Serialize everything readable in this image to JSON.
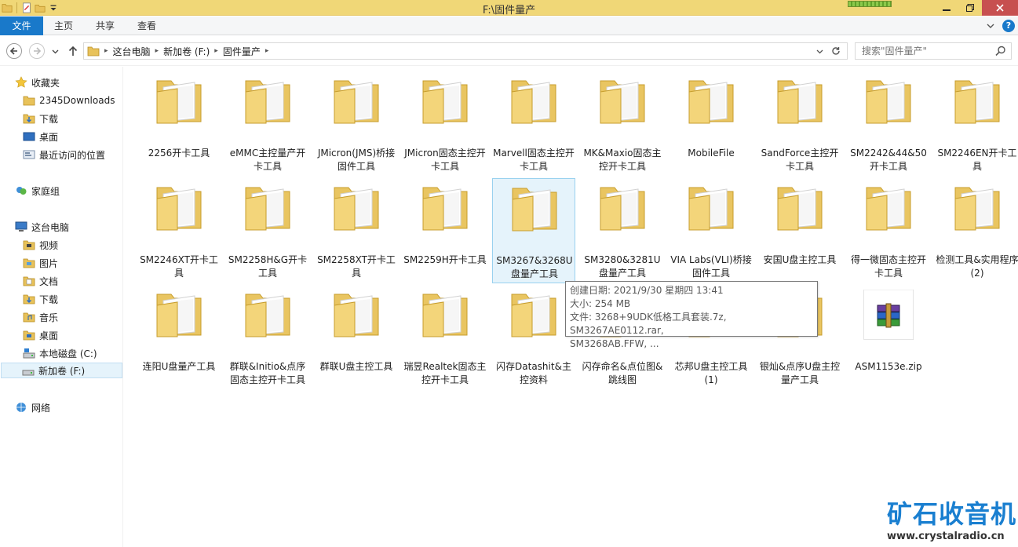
{
  "window": {
    "title": "F:\\固件量产",
    "colors": {
      "titlebar": "#f0d777",
      "file_tab": "#1979ca",
      "selection": "#e5f3fb"
    }
  },
  "ribbon": {
    "tabs": [
      {
        "label": "文件"
      },
      {
        "label": "主页"
      },
      {
        "label": "共享"
      },
      {
        "label": "查看"
      }
    ]
  },
  "address": {
    "crumbs": [
      "这台电脑",
      "新加卷 (F:)",
      "固件量产"
    ]
  },
  "search": {
    "placeholder": "搜索\"固件量产\""
  },
  "sidebar": {
    "favorites": {
      "label": "收藏夹",
      "items": [
        "2345Downloads",
        "下载",
        "桌面",
        "最近访问的位置"
      ]
    },
    "homegroup": {
      "label": "家庭组"
    },
    "thispc": {
      "label": "这台电脑",
      "items": [
        "视频",
        "图片",
        "文档",
        "下载",
        "音乐",
        "桌面",
        "本地磁盘 (C:)",
        "新加卷 (F:)"
      ]
    },
    "network": {
      "label": "网络"
    }
  },
  "files": [
    {
      "name": "2256开卡工具",
      "icon": "folder-icon"
    },
    {
      "name": "eMMC主控量产开卡工具",
      "icon": "folder-icon"
    },
    {
      "name": "JMicron(JMS)桥接固件工具",
      "icon": "folder-icon"
    },
    {
      "name": "JMicron固态主控开卡工具",
      "icon": "folder-icon"
    },
    {
      "name": "Marvell固态主控开卡工具",
      "icon": "folder-icon"
    },
    {
      "name": "MK&Maxio固态主控开卡工具",
      "icon": "folder-icon"
    },
    {
      "name": "MobileFile",
      "icon": "folder-icon"
    },
    {
      "name": "SandForce主控开卡工具",
      "icon": "folder-icon"
    },
    {
      "name": "SM2242&44&50开卡工具",
      "icon": "folder-icon"
    },
    {
      "name": "SM2246EN开卡工具",
      "icon": "folder-icon"
    },
    {
      "name": "SM2246XT开卡工具",
      "icon": "folder-icon"
    },
    {
      "name": "SM2258H&G开卡工具",
      "icon": "folder-icon"
    },
    {
      "name": "SM2258XT开卡工具",
      "icon": "folder-icon"
    },
    {
      "name": "SM2259H开卡工具",
      "icon": "folder-icon"
    },
    {
      "name": "SM3267&3268U盘量产工具",
      "icon": "folder-icon"
    },
    {
      "name": "SM3280&3281U盘量产工具",
      "icon": "folder-icon"
    },
    {
      "name": "VIA Labs(VLI)桥接固件工具",
      "icon": "folder-icon"
    },
    {
      "name": "安国U盘主控工具",
      "icon": "folder-icon"
    },
    {
      "name": "得一微固态主控开卡工具",
      "icon": "folder-icon"
    },
    {
      "name": "检测工具&实用程序 (2)",
      "icon": "folder-icon"
    },
    {
      "name": "连阳U盘量产工具",
      "icon": "folder-icon"
    },
    {
      "name": "群联&Initio&点序固态主控开卡工具",
      "icon": "folder-icon"
    },
    {
      "name": "群联U盘主控工具",
      "icon": "folder-icon"
    },
    {
      "name": "瑞昱Realtek固态主控开卡工具",
      "icon": "folder-icon"
    },
    {
      "name": "闪存Datashit&主控资料",
      "icon": "folder-icon"
    },
    {
      "name": "闪存命名&点位图&跳线图",
      "icon": "folder-icon"
    },
    {
      "name": "芯邦U盘主控工具 (1)",
      "icon": "folder-icon"
    },
    {
      "name": "银灿&点序U盘主控量产工具",
      "icon": "folder-icon"
    },
    {
      "name": "ASM1153e.zip",
      "icon": "winrar-archive-icon"
    }
  ],
  "tooltip": {
    "line1": "创建日期: 2021/9/30 星期四 13:41",
    "line2": "大小: 254 MB",
    "line3": "文件: 3268+9UDK低格工具套装.7z, SM3267AE0112.rar,",
    "line4": "SM3268AB.FFW, ..."
  },
  "watermark": {
    "title": "矿石收音机",
    "url": "www.crystalradio.cn"
  }
}
